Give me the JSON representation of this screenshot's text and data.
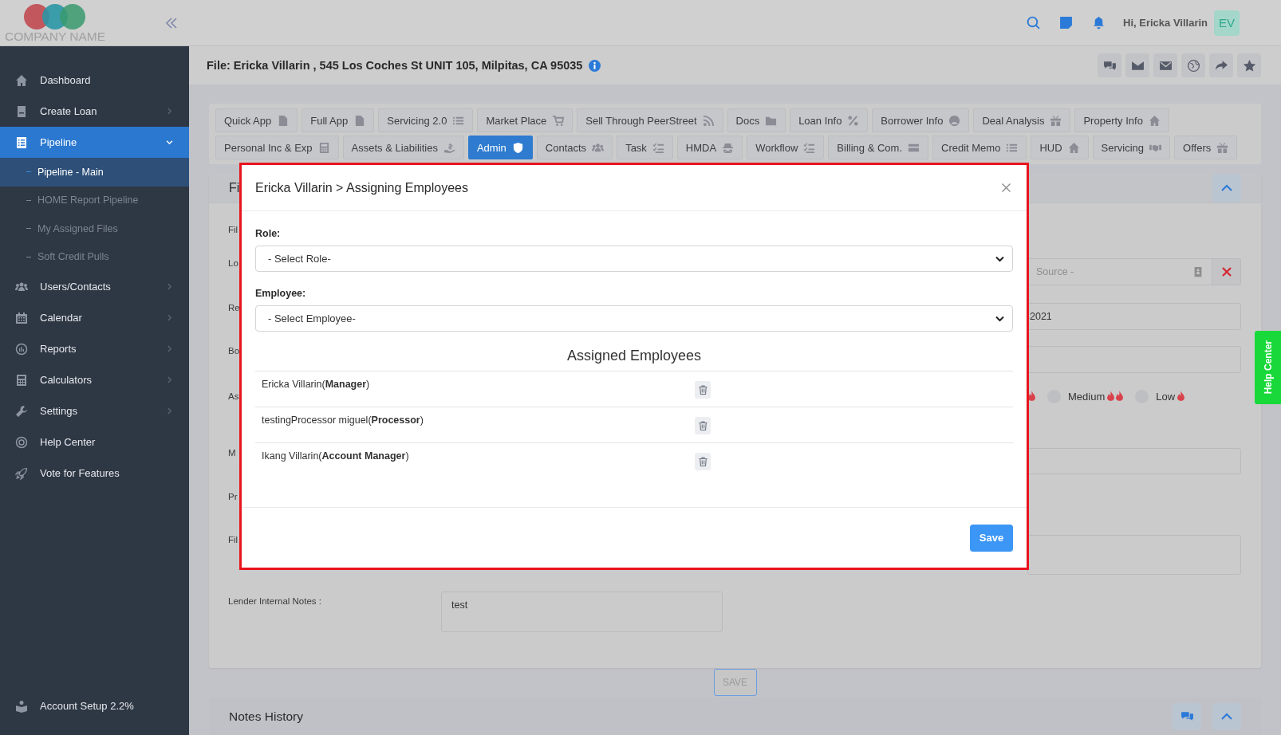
{
  "header": {
    "company_name": "COMPANY NAME",
    "greeting": "Hi, Ericka Villarin",
    "avatar": "EV"
  },
  "sidebar": {
    "items": [
      {
        "label": "Dashboard",
        "kind": "link",
        "selected": false
      },
      {
        "label": "Create Loan",
        "kind": "menu",
        "selected": false
      },
      {
        "label": "Pipeline",
        "kind": "menu",
        "expanded": true,
        "selected": true,
        "children": [
          {
            "label": "Pipeline - Main",
            "selected": true
          },
          {
            "label": "HOME Report Pipeline",
            "selected": false
          },
          {
            "label": "My Assigned Files",
            "selected": false
          },
          {
            "label": "Soft Credit Pulls",
            "selected": false
          }
        ]
      },
      {
        "label": "Users/Contacts",
        "kind": "menu",
        "selected": false
      },
      {
        "label": "Calendar",
        "kind": "menu",
        "selected": false
      },
      {
        "label": "Reports",
        "kind": "menu",
        "selected": false
      },
      {
        "label": "Calculators",
        "kind": "menu",
        "selected": false
      },
      {
        "label": "Settings",
        "kind": "menu",
        "selected": false
      },
      {
        "label": "Help Center",
        "kind": "link",
        "selected": false
      },
      {
        "label": "Vote for Features",
        "kind": "link",
        "selected": false
      }
    ],
    "footer": "Account Setup 2.2%"
  },
  "file_bar": {
    "title": "File: Ericka Villarin , 545 Los Coches St UNIT 105, Milpitas, CA 95035"
  },
  "tab_rows": [
    {
      "tabs": [
        {
          "label": "Quick App",
          "selected": false
        },
        {
          "label": "Full App",
          "selected": false
        },
        {
          "label": "Servicing 2.0",
          "selected": false
        },
        {
          "label": "Market Place",
          "selected": false
        },
        {
          "label": "Sell Through PeerStreet",
          "selected": false
        },
        {
          "label": "Docs",
          "selected": false
        },
        {
          "label": "Loan Info",
          "selected": false
        },
        {
          "label": "Borrower Info",
          "selected": false
        },
        {
          "label": "Deal Analysis",
          "selected": false
        },
        {
          "label": "Property Info",
          "selected": false
        }
      ]
    },
    {
      "tabs": [
        {
          "label": "Personal Inc & Exp",
          "selected": false
        },
        {
          "label": "Assets & Liabilities",
          "selected": false
        },
        {
          "label": "Admin",
          "selected": true
        },
        {
          "label": "Contacts",
          "selected": false
        },
        {
          "label": "Task",
          "selected": false
        },
        {
          "label": "HMDA",
          "selected": false
        },
        {
          "label": "Workflow",
          "selected": false
        },
        {
          "label": "Billing & Com.",
          "selected": false
        },
        {
          "label": "Credit Memo",
          "selected": false
        },
        {
          "label": "HUD",
          "selected": false
        },
        {
          "label": "Servicing",
          "selected": false
        },
        {
          "label": "Offers",
          "selected": false
        }
      ]
    }
  ],
  "form": {
    "section_title": "Fi",
    "labels": [
      "Fil",
      "Lo",
      "Re",
      "Bo",
      "As",
      "M",
      "Pr",
      "Fil"
    ],
    "source": {
      "placeholder": "Source -"
    },
    "date_value": "2021",
    "priority": [
      {
        "label": "Medium",
        "kind": "medium",
        "selected": false
      },
      {
        "label": "Low",
        "kind": "low",
        "selected": false
      }
    ],
    "lender_notes_label": "Lender Internal Notes :",
    "lender_notes_value": "test"
  },
  "save_button": "SAVE",
  "notes_history": {
    "title": "Notes History"
  },
  "help_tab": "Help Center",
  "modal": {
    "title": "Ericka Villarin > Assigning Employees",
    "role_label": "Role:",
    "role_placeholder": "- Select Role-",
    "employee_label": "Employee:",
    "employee_placeholder": "- Select Employee-",
    "list_title": "Assigned Employees",
    "assigned": [
      {
        "name": "Ericka Villarin(**Manager**)"
      },
      {
        "name": "testingProcessor miguel(**Processor**)"
      },
      {
        "name": "Ikang Villarin(**Account Manager**)"
      }
    ],
    "save_button": "Save"
  }
}
